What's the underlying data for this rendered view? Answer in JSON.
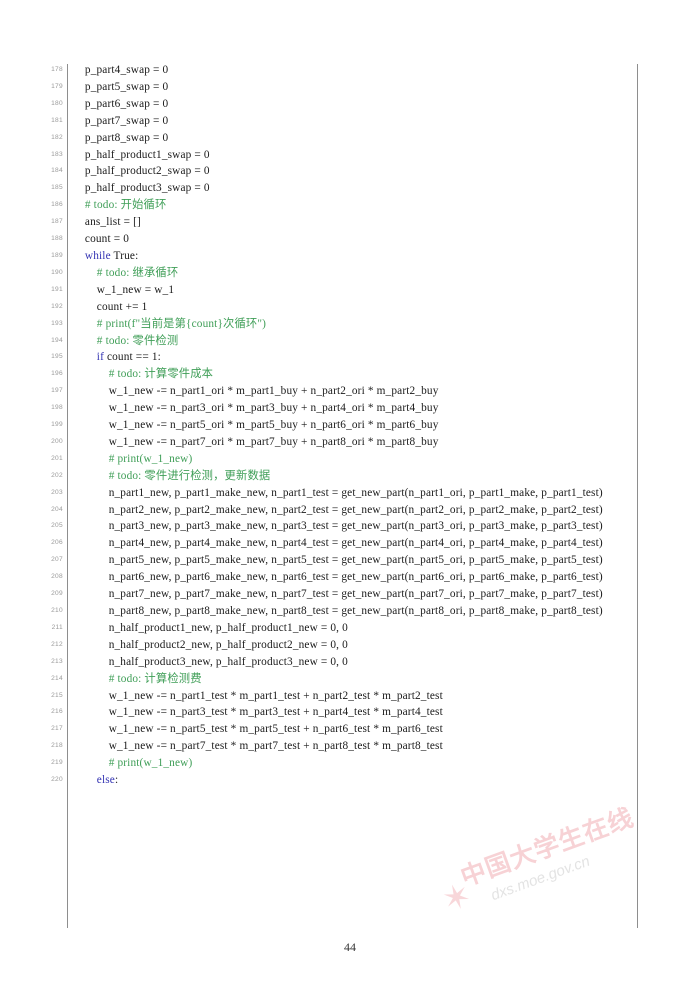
{
  "document": {
    "page_number": "44",
    "watermark": {
      "text_cn": "中国大学生在线",
      "url": "dxs.moe.gov.cn",
      "logo": "star-icon",
      "color": "#f0a6ad"
    },
    "colors": {
      "keyword": "#3434b3",
      "comment": "#3f9e57",
      "plain": "#1a1a1a",
      "lineno": "#9a9a9a",
      "rule": "#8e8e8e"
    }
  },
  "listing": {
    "first_line_number": 178,
    "lines": [
      {
        "n": "178",
        "segments": [
          {
            "cls": "txt",
            "t": "    p_part4_swap = 0"
          }
        ]
      },
      {
        "n": "179",
        "segments": [
          {
            "cls": "txt",
            "t": "    p_part5_swap = 0"
          }
        ]
      },
      {
        "n": "180",
        "segments": [
          {
            "cls": "txt",
            "t": "    p_part6_swap = 0"
          }
        ]
      },
      {
        "n": "181",
        "segments": [
          {
            "cls": "txt",
            "t": "    p_part7_swap = 0"
          }
        ]
      },
      {
        "n": "182",
        "segments": [
          {
            "cls": "txt",
            "t": "    p_part8_swap = 0"
          }
        ]
      },
      {
        "n": "183",
        "segments": [
          {
            "cls": "txt",
            "t": "    p_half_product1_swap = 0"
          }
        ]
      },
      {
        "n": "184",
        "segments": [
          {
            "cls": "txt",
            "t": "    p_half_product2_swap = 0"
          }
        ]
      },
      {
        "n": "185",
        "segments": [
          {
            "cls": "txt",
            "t": "    p_half_product3_swap = 0"
          }
        ]
      },
      {
        "n": "186",
        "segments": [
          {
            "cls": "cmt",
            "t": "    # todo: 开始循环"
          }
        ]
      },
      {
        "n": "187",
        "segments": [
          {
            "cls": "txt",
            "t": "    ans_list = []"
          }
        ]
      },
      {
        "n": "188",
        "segments": [
          {
            "cls": "txt",
            "t": "    count = 0"
          }
        ]
      },
      {
        "n": "189",
        "segments": [
          {
            "cls": "kw",
            "t": "    while"
          },
          {
            "cls": "txt",
            "t": " True:"
          }
        ]
      },
      {
        "n": "190",
        "segments": [
          {
            "cls": "cmt",
            "t": "        # todo: 继承循环"
          }
        ]
      },
      {
        "n": "191",
        "segments": [
          {
            "cls": "txt",
            "t": "        w_1_new = w_1"
          }
        ]
      },
      {
        "n": "192",
        "segments": [
          {
            "cls": "txt",
            "t": "        count += 1"
          }
        ]
      },
      {
        "n": "193",
        "segments": [
          {
            "cls": "cmt",
            "t": "        # print(f\"当前是第{count}次循环\")"
          }
        ]
      },
      {
        "n": "194",
        "segments": [
          {
            "cls": "cmt",
            "t": "        # todo: 零件检测"
          }
        ]
      },
      {
        "n": "195",
        "segments": [
          {
            "cls": "kw",
            "t": "        if"
          },
          {
            "cls": "txt",
            "t": " count == 1:"
          }
        ]
      },
      {
        "n": "196",
        "segments": [
          {
            "cls": "cmt",
            "t": "            # todo: 计算零件成本"
          }
        ]
      },
      {
        "n": "197",
        "segments": [
          {
            "cls": "txt",
            "t": "            w_1_new -= n_part1_ori * m_part1_buy + n_part2_ori * m_part2_buy"
          }
        ]
      },
      {
        "n": "198",
        "segments": [
          {
            "cls": "txt",
            "t": "            w_1_new -= n_part3_ori * m_part3_buy + n_part4_ori * m_part4_buy"
          }
        ]
      },
      {
        "n": "199",
        "segments": [
          {
            "cls": "txt",
            "t": "            w_1_new -= n_part5_ori * m_part5_buy + n_part6_ori * m_part6_buy"
          }
        ]
      },
      {
        "n": "200",
        "segments": [
          {
            "cls": "txt",
            "t": "            w_1_new -= n_part7_ori * m_part7_buy + n_part8_ori * m_part8_buy"
          }
        ]
      },
      {
        "n": "201",
        "segments": [
          {
            "cls": "cmt",
            "t": "            # print(w_1_new)"
          }
        ]
      },
      {
        "n": "202",
        "segments": [
          {
            "cls": "cmt",
            "t": "            # todo: 零件进行检测，更新数据"
          }
        ]
      },
      {
        "n": "203",
        "segments": [
          {
            "cls": "txt",
            "t": "            n_part1_new, p_part1_make_new, n_part1_test = get_new_part(n_part1_ori, p_part1_make, p_part1_test)"
          }
        ]
      },
      {
        "n": "204",
        "segments": [
          {
            "cls": "txt",
            "t": "            n_part2_new, p_part2_make_new, n_part2_test = get_new_part(n_part2_ori, p_part2_make, p_part2_test)"
          }
        ]
      },
      {
        "n": "205",
        "segments": [
          {
            "cls": "txt",
            "t": "            n_part3_new, p_part3_make_new, n_part3_test = get_new_part(n_part3_ori, p_part3_make, p_part3_test)"
          }
        ]
      },
      {
        "n": "206",
        "segments": [
          {
            "cls": "txt",
            "t": "            n_part4_new, p_part4_make_new, n_part4_test = get_new_part(n_part4_ori, p_part4_make, p_part4_test)"
          }
        ]
      },
      {
        "n": "207",
        "segments": [
          {
            "cls": "txt",
            "t": "            n_part5_new, p_part5_make_new, n_part5_test = get_new_part(n_part5_ori, p_part5_make, p_part5_test)"
          }
        ]
      },
      {
        "n": "208",
        "segments": [
          {
            "cls": "txt",
            "t": "            n_part6_new, p_part6_make_new, n_part6_test = get_new_part(n_part6_ori, p_part6_make, p_part6_test)"
          }
        ]
      },
      {
        "n": "209",
        "segments": [
          {
            "cls": "txt",
            "t": "            n_part7_new, p_part7_make_new, n_part7_test = get_new_part(n_part7_ori, p_part7_make, p_part7_test)"
          }
        ]
      },
      {
        "n": "210",
        "segments": [
          {
            "cls": "txt",
            "t": "            n_part8_new, p_part8_make_new, n_part8_test = get_new_part(n_part8_ori, p_part8_make, p_part8_test)"
          }
        ]
      },
      {
        "n": "211",
        "segments": [
          {
            "cls": "txt",
            "t": "            n_half_product1_new, p_half_product1_new = 0, 0"
          }
        ]
      },
      {
        "n": "212",
        "segments": [
          {
            "cls": "txt",
            "t": "            n_half_product2_new, p_half_product2_new = 0, 0"
          }
        ]
      },
      {
        "n": "213",
        "segments": [
          {
            "cls": "txt",
            "t": "            n_half_product3_new, p_half_product3_new = 0, 0"
          }
        ]
      },
      {
        "n": "214",
        "segments": [
          {
            "cls": "cmt",
            "t": "            # todo: 计算检测费"
          }
        ]
      },
      {
        "n": "215",
        "segments": [
          {
            "cls": "txt",
            "t": "            w_1_new -= n_part1_test * m_part1_test + n_part2_test * m_part2_test"
          }
        ]
      },
      {
        "n": "216",
        "segments": [
          {
            "cls": "txt",
            "t": "            w_1_new -= n_part3_test * m_part3_test + n_part4_test * m_part4_test"
          }
        ]
      },
      {
        "n": "217",
        "segments": [
          {
            "cls": "txt",
            "t": "            w_1_new -= n_part5_test * m_part5_test + n_part6_test * m_part6_test"
          }
        ]
      },
      {
        "n": "218",
        "segments": [
          {
            "cls": "txt",
            "t": "            w_1_new -= n_part7_test * m_part7_test + n_part8_test * m_part8_test"
          }
        ]
      },
      {
        "n": "219",
        "segments": [
          {
            "cls": "cmt",
            "t": "            # print(w_1_new)"
          }
        ]
      },
      {
        "n": "220",
        "segments": [
          {
            "cls": "kw",
            "t": "        else"
          },
          {
            "cls": "txt",
            "t": ":"
          }
        ]
      }
    ]
  }
}
